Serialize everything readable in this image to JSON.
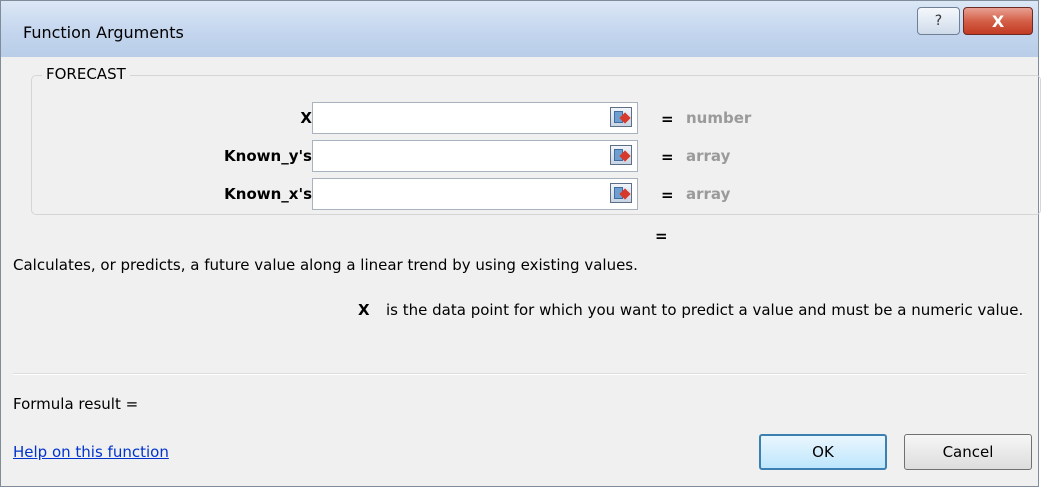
{
  "window": {
    "title": "Function Arguments",
    "help_glyph": "?",
    "close_glyph": "X"
  },
  "function": {
    "name": "FORECAST",
    "arguments": [
      {
        "label": "X",
        "value": "",
        "type": "number"
      },
      {
        "label": "Known_y's",
        "value": "",
        "type": "array"
      },
      {
        "label": "Known_x's",
        "value": "",
        "type": "array"
      }
    ],
    "equals": "=",
    "total_equals": "=",
    "description": "Calculates, or predicts, a future value along a linear trend by using existing values.",
    "arg_help_name": "X",
    "arg_help_text": "is the data point for which you want to predict a value and must be a numeric value."
  },
  "footer": {
    "formula_result": "Formula result =",
    "help_link": "Help on this function",
    "ok_label": "OK",
    "cancel_label": "Cancel"
  },
  "colors": {
    "titlebar": "#c4d6ee",
    "close_button": "#c23b22",
    "link": "#0033cc",
    "type_hint": "#9a9a9a"
  }
}
